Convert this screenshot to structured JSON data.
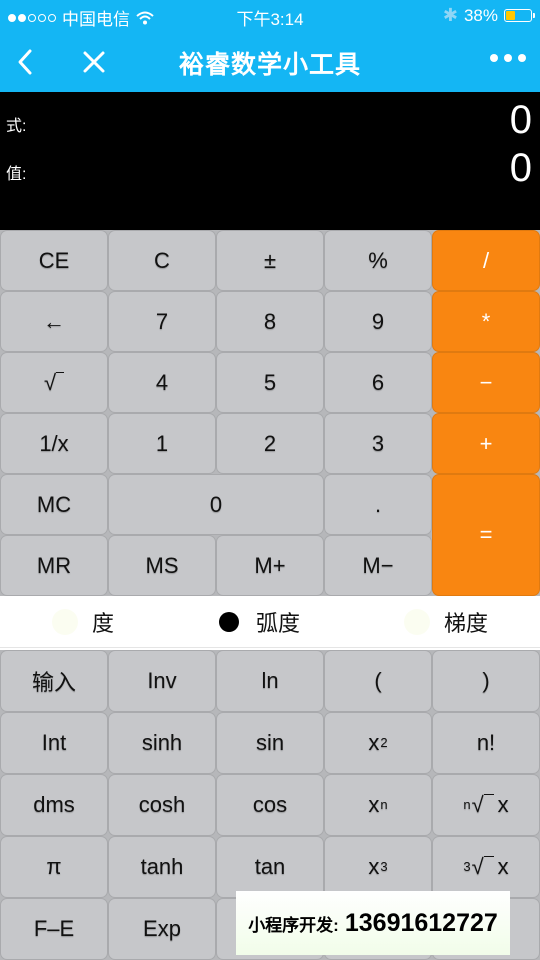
{
  "status_bar": {
    "carrier": "中国电信",
    "signal_strength": 2,
    "signal_max": 5,
    "time": "下午3:14",
    "battery_percent_label": "38%",
    "battery_level": 0.38
  },
  "nav": {
    "title": "裕睿数学小工具",
    "back_icon": "chevron-left-icon",
    "close_icon": "close-icon",
    "more_icon": "more-dots-icon"
  },
  "display": {
    "expression_label": "式:",
    "expression_value": "0",
    "value_label": "值:",
    "result_value": "0"
  },
  "keypad_basic": [
    "CE",
    "C",
    "±",
    "%",
    "/",
    "←",
    "7",
    "8",
    "9",
    "*",
    "√",
    "4",
    "5",
    "6",
    "−",
    "1/x",
    "1",
    "2",
    "3",
    "+",
    "MC",
    "0",
    ".",
    "=",
    "MR",
    "MS",
    "M+",
    "M−"
  ],
  "angle_mode": {
    "options": [
      "度",
      "弧度",
      "梯度"
    ],
    "selected": "弧度"
  },
  "keypad_scientific": {
    "row1": [
      "输入",
      "Inv",
      "ln",
      "(",
      ")"
    ],
    "row2": [
      "Int",
      "sinh",
      "sin",
      "x",
      "n!"
    ],
    "row2_sup": "2",
    "row3": [
      "dms",
      "cosh",
      "cos",
      "x",
      "x"
    ],
    "row3_sup": "n",
    "row3_root_index": "n",
    "row4": [
      "π",
      "tanh",
      "tan",
      "x",
      "x"
    ],
    "row4_sup": "3",
    "row4_root_index": "3",
    "row5": [
      "F–E",
      "Exp",
      "",
      "",
      ""
    ]
  },
  "banner": {
    "label": "小程序开发:",
    "phone": "13691612727"
  },
  "colors": {
    "nav_blue": "#14b6f4",
    "operator_orange": "#f98611",
    "key_gray": "#c6c7ca",
    "battery_yellow": "#ffc800"
  }
}
